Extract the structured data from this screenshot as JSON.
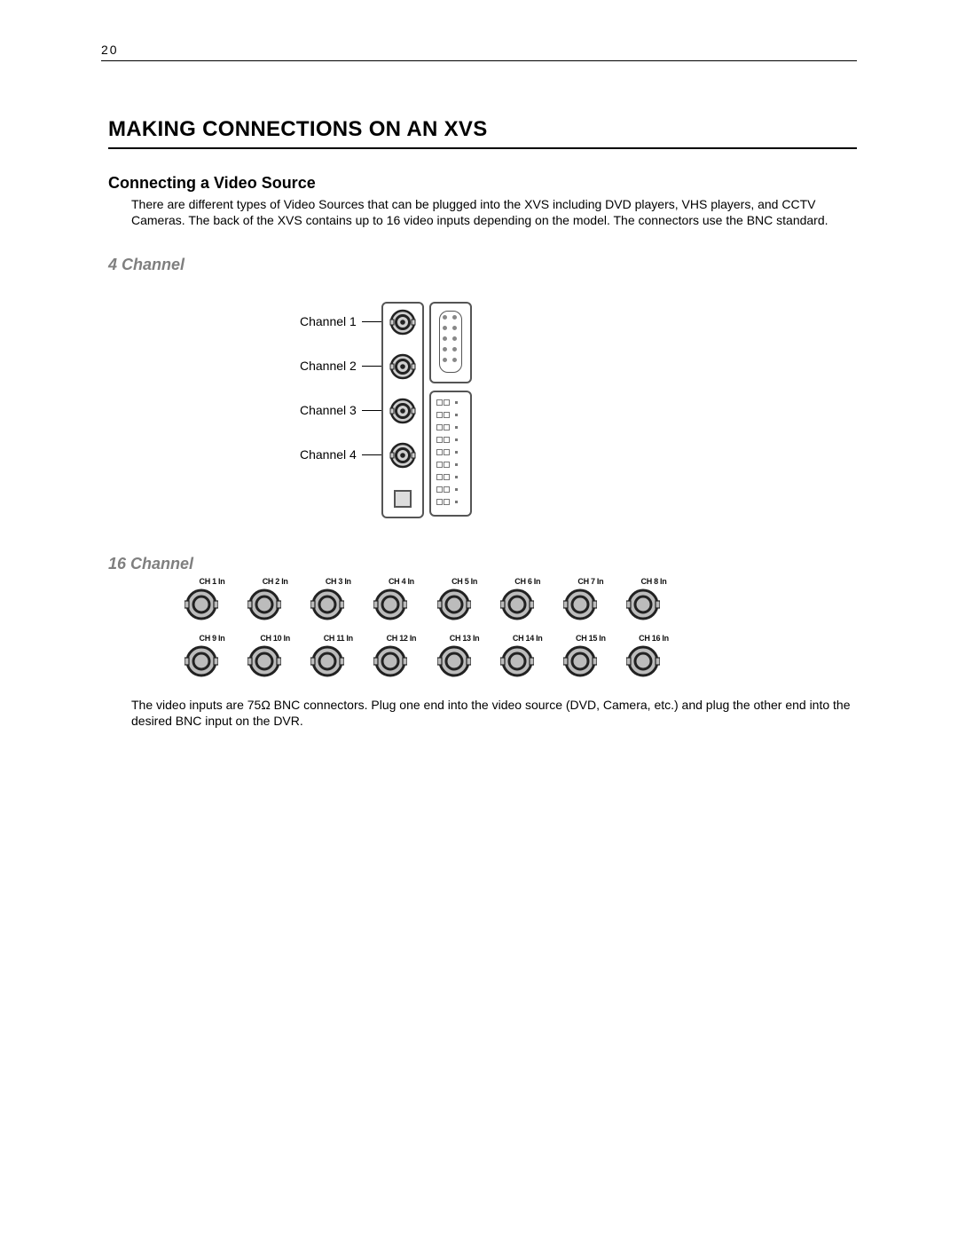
{
  "page_number": "20",
  "heading1": "MAKING CONNECTIONS ON AN XVS",
  "heading2": "Connecting a Video Source",
  "intro_para": "There are different types of Video Sources that can be plugged into the XVS including DVD players, VHS players, and CCTV Cameras. The back of the XVS contains up to 16 video inputs depending on the model. The connectors use the BNC standard.",
  "section_4ch": "4 Channel",
  "ch_labels": [
    "Channel 1",
    "Channel 2",
    "Channel 3",
    "Channel 4"
  ],
  "section_16ch": "16 Channel",
  "labels_16_row1": [
    "CH 1 In",
    "CH 2 In",
    "CH 3 In",
    "CH 4 In",
    "CH 5 In",
    "CH 6 In",
    "CH 7 In",
    "CH 8 In"
  ],
  "labels_16_row2": [
    "CH 9 In",
    "CH 10 In",
    "CH 11 In",
    "CH 12 In",
    "CH 13 In",
    "CH 14 In",
    "CH 15 In",
    "CH 16 In"
  ],
  "closing_para": "The video inputs are 75Ω BNC connectors. Plug one end into the video source (DVD, Camera, etc.) and plug the other end into the desired BNC input on the DVR."
}
